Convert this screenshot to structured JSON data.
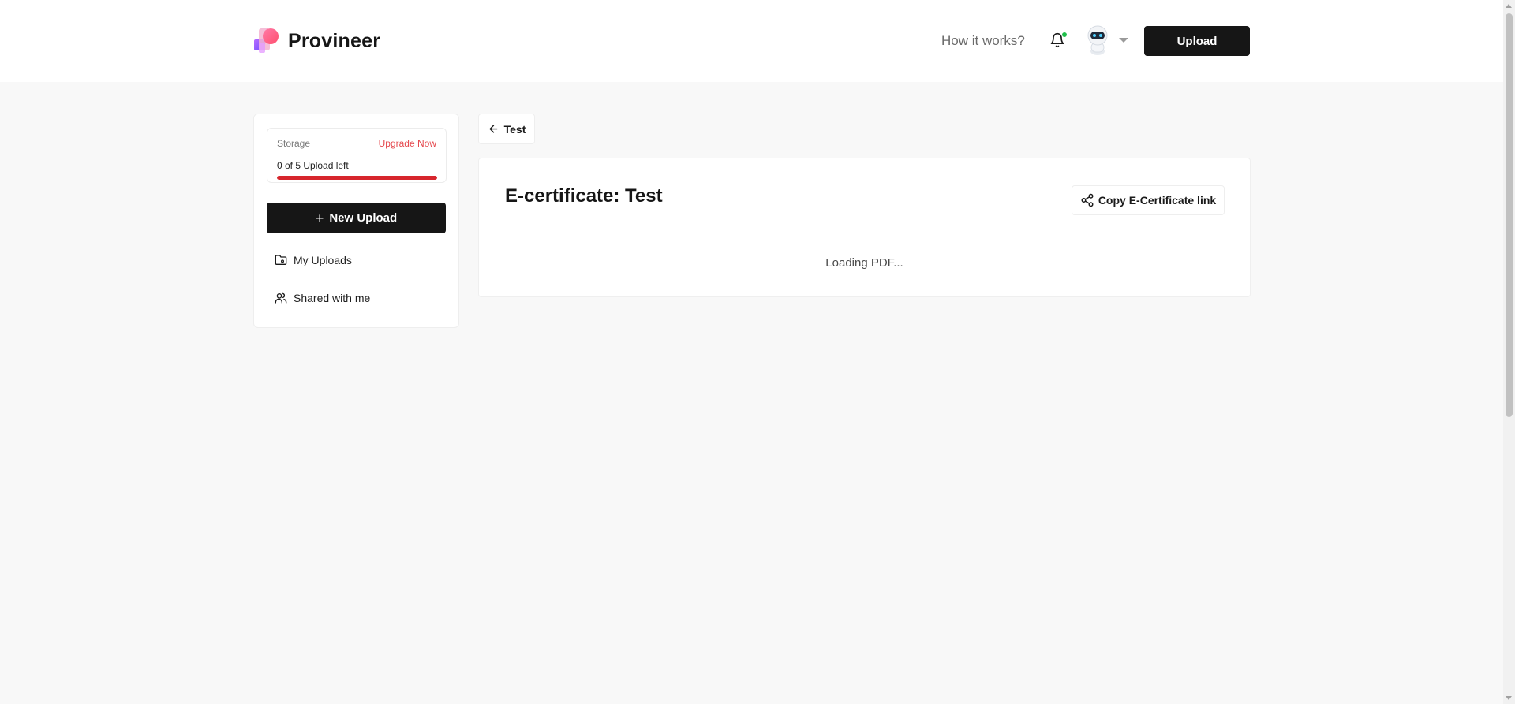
{
  "header": {
    "brand_name": "Provineer",
    "nav_link": "How it works?",
    "upload_label": "Upload",
    "notification_status_color": "#1fbf4a"
  },
  "sidebar": {
    "storage": {
      "label": "Storage",
      "upgrade_label": "Upgrade Now",
      "uploads_left_text": "0 of 5 Upload left",
      "used_fraction": 1.0,
      "bar_color": "#d7262d"
    },
    "new_upload_label": "New Upload",
    "items": [
      {
        "label": "My Uploads",
        "icon": "folder-icon"
      },
      {
        "label": "Shared with me",
        "icon": "users-icon"
      }
    ]
  },
  "main": {
    "back_label": "Test",
    "title": "E-certificate: Test",
    "copy_label": "Copy E-Certificate link",
    "loading_text": "Loading PDF..."
  },
  "colors": {
    "primary_dark": "#161616",
    "accent_red": "#e5484d",
    "page_bg": "#f8f8f8"
  }
}
